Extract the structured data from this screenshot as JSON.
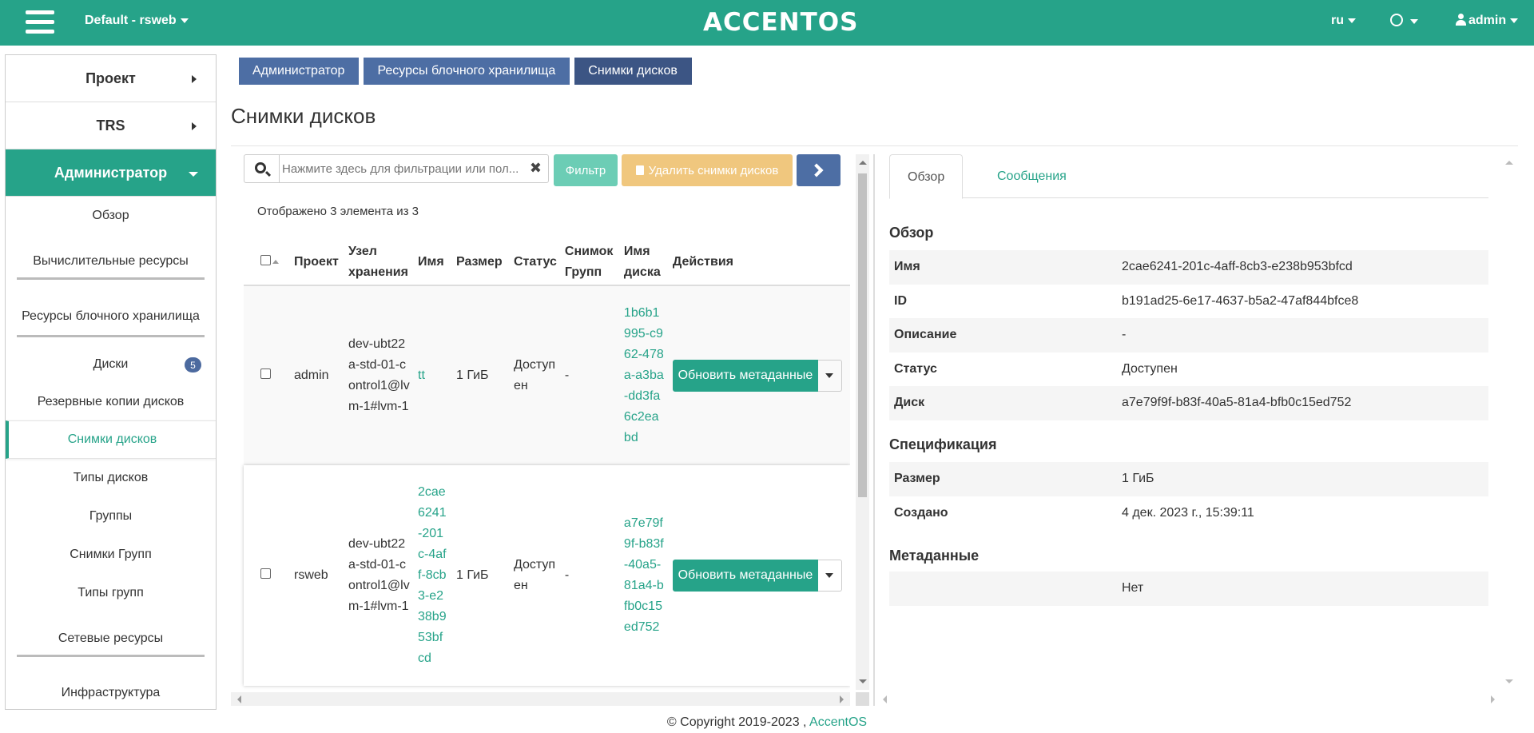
{
  "topbar": {
    "project": "Default - rsweb",
    "logo": "ACCENTOS",
    "language": "ru",
    "user": "admin"
  },
  "sidebar": {
    "project": "Проект",
    "trs": "TRS",
    "admin": "Администратор",
    "items": [
      {
        "label": "Обзор"
      },
      {
        "label": "Вычислительные ресурсы"
      },
      {
        "label": "Ресурсы блочного хранилища"
      },
      {
        "label": "Диски",
        "badge": "5"
      },
      {
        "label": "Резервные копии дисков"
      },
      {
        "label": "Снимки дисков"
      },
      {
        "label": "Типы дисков"
      },
      {
        "label": "Группы"
      },
      {
        "label": "Снимки Групп"
      },
      {
        "label": "Типы групп"
      },
      {
        "label": "Сетевые ресурсы"
      },
      {
        "label": "Инфраструктура"
      }
    ]
  },
  "breadcrumb": [
    "Администратор",
    "Ресурсы блочного хранилища",
    "Снимки дисков"
  ],
  "page_title": "Снимки дисков",
  "toolbar": {
    "search_placeholder": "Нажмите здесь для фильтрации или пол...",
    "clear": "✖",
    "filter": "Фильтр",
    "delete": "Удалить снимки дисков"
  },
  "table": {
    "count": "Отображено 3 элемента из 3",
    "columns": [
      "Проект",
      "Узел хранения",
      "Имя",
      "Размер",
      "Статус",
      "Снимок Групп",
      "Имя диска",
      "Действия"
    ],
    "rows": [
      {
        "project": "admin",
        "host": "dev-ubt22a-std-01-control1@lvm-1#lvm-1",
        "name": "tt",
        "size": "1 ГиБ",
        "status": "Доступен",
        "group": "-",
        "disk": "1b6b1995-c962-478a-a3ba-dd3fa6c2eabd",
        "action": "Обновить метаданные"
      },
      {
        "project": "rsweb",
        "host": "dev-ubt22a-std-01-control1@lvm-1#lvm-1",
        "name": "2cae6241-201c-4aff-8cb3-e238b953bfcd",
        "size": "1 ГиБ",
        "status": "Доступен",
        "group": "-",
        "disk": "a7e79f9f-b83f-40a5-81a4-bfb0c15ed752",
        "action": "Обновить метаданные"
      }
    ]
  },
  "detail": {
    "tabs": [
      "Обзор",
      "Сообщения"
    ],
    "overview_title": "Обзор",
    "overview": [
      {
        "k": "Имя",
        "v": "2cae6241-201c-4aff-8cb3-e238b953bfcd"
      },
      {
        "k": "ID",
        "v": "b191ad25-6e17-4637-b5a2-47af844bfce8"
      },
      {
        "k": "Описание",
        "v": "-"
      },
      {
        "k": "Статус",
        "v": "Доступен"
      },
      {
        "k": "Диск",
        "v": "a7e79f9f-b83f-40a5-81a4-bfb0c15ed752"
      }
    ],
    "spec_title": "Спецификация",
    "spec": [
      {
        "k": "Размер",
        "v": "1 ГиБ"
      },
      {
        "k": "Создано",
        "v": "4 дек. 2023 г., 15:39:11"
      }
    ],
    "meta_title": "Метаданные",
    "meta_value": "Нет"
  },
  "footer": {
    "text": "© Copyright 2019-2023 , ",
    "link": "AccentOS"
  },
  "colors": {
    "accent": "#26a389",
    "nav": "#4d6ea4",
    "warning": "#f0c77e"
  }
}
